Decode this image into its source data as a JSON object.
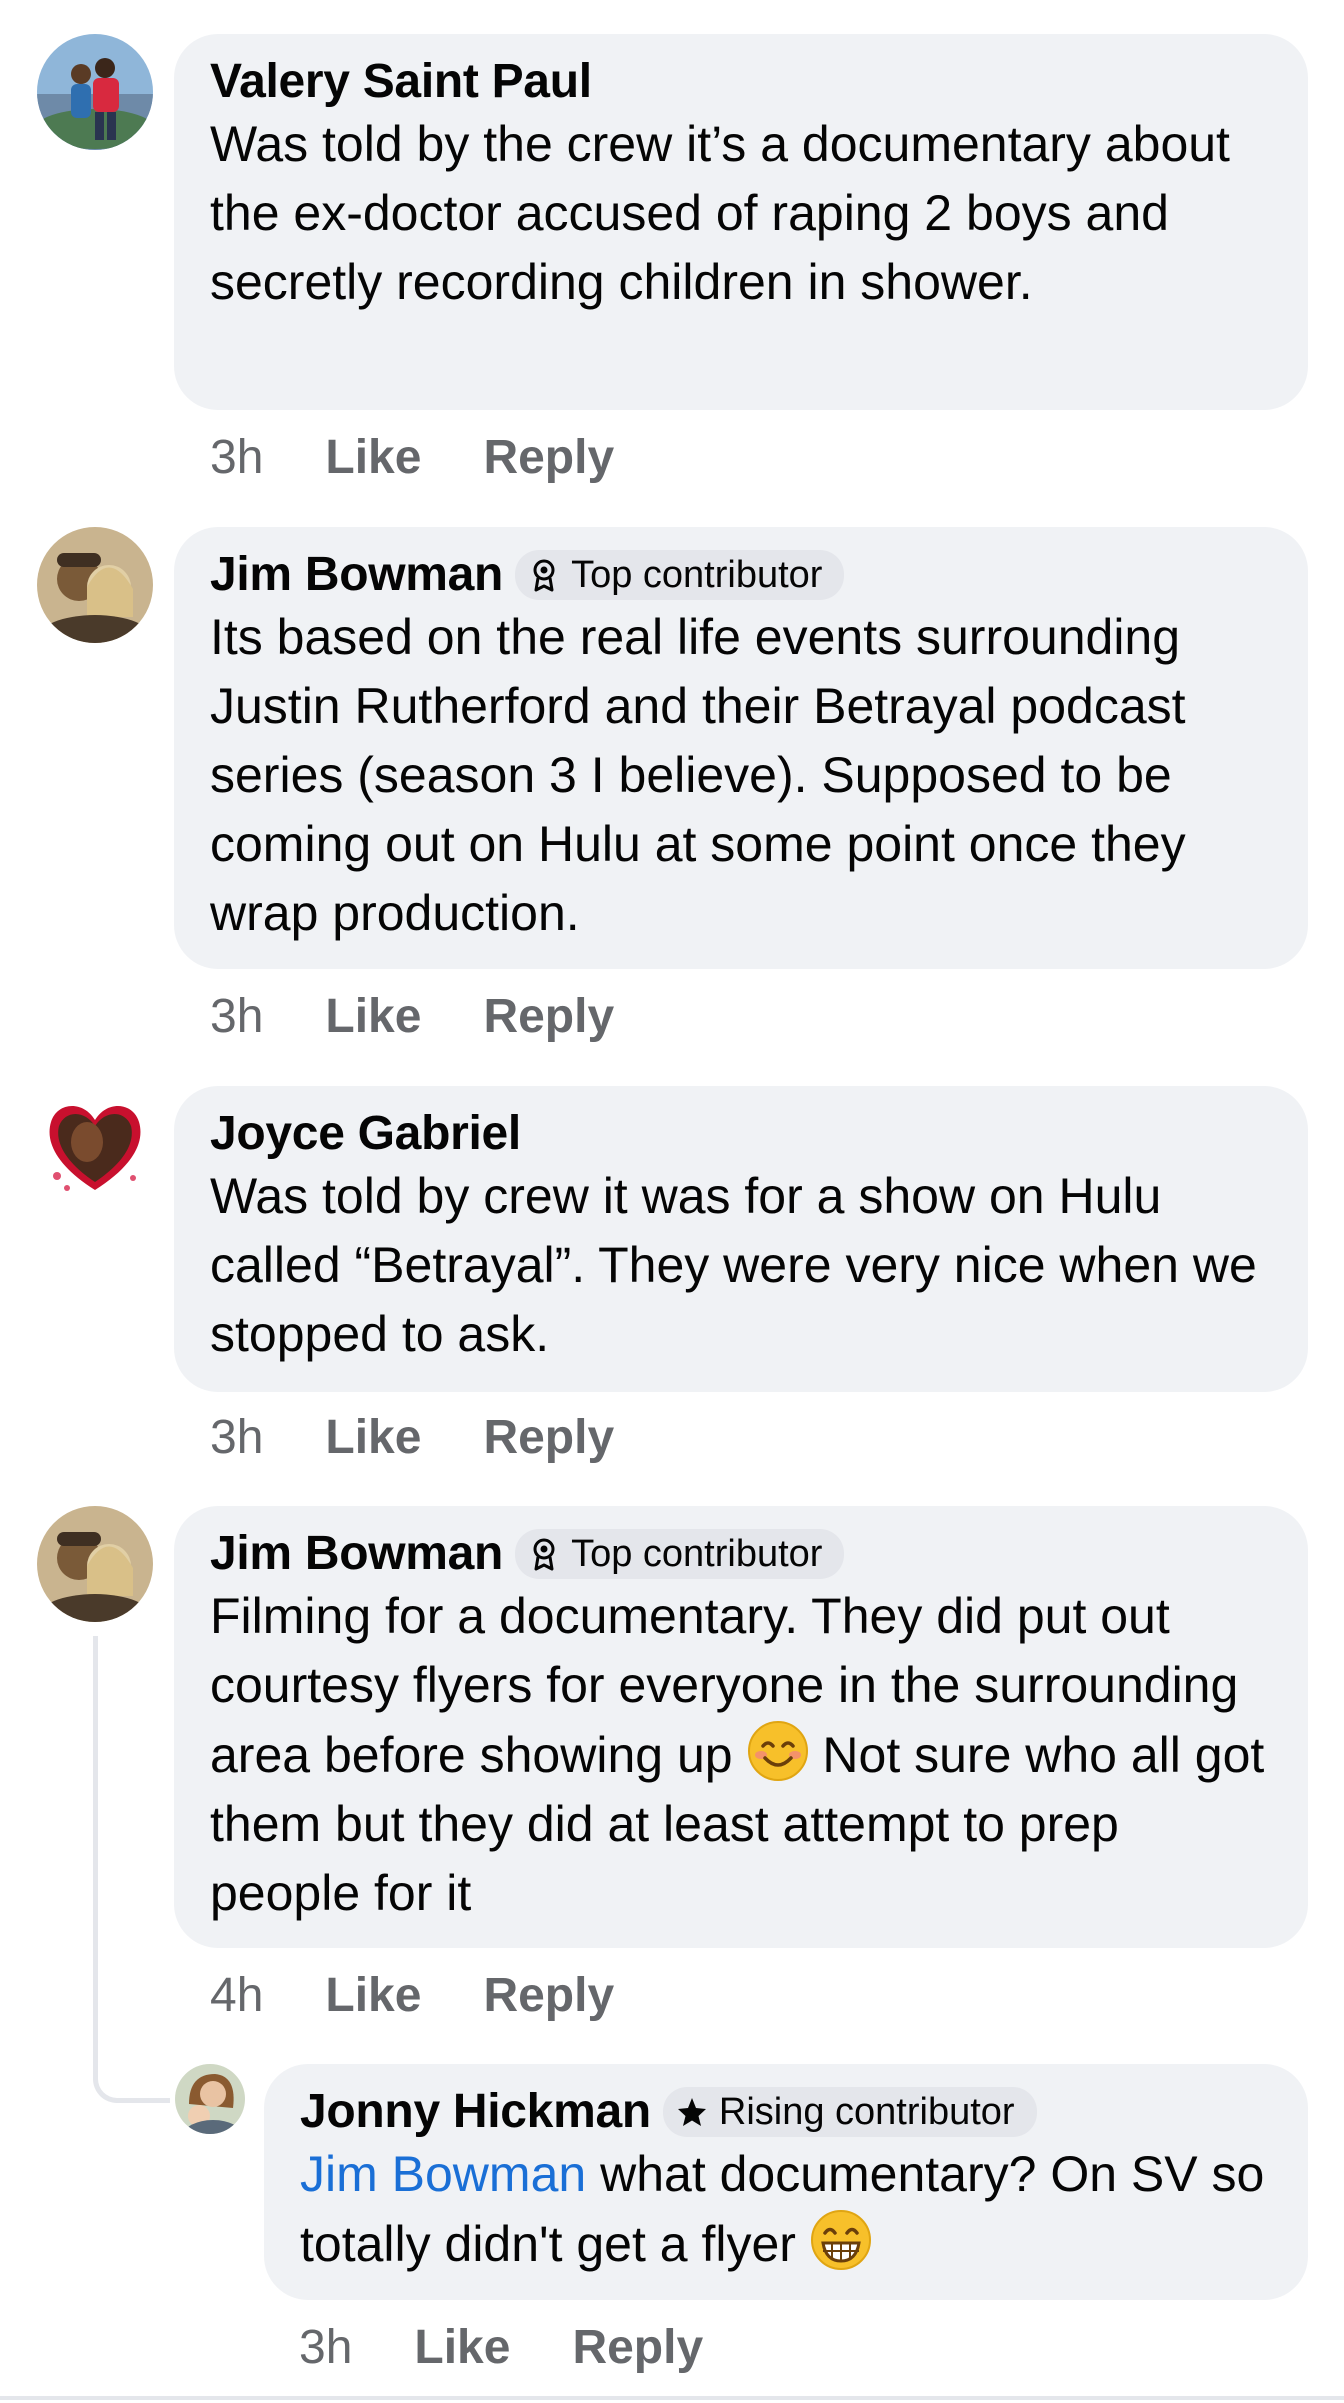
{
  "comments": [
    {
      "author": "Valery Saint Paul",
      "badge": null,
      "text": "Was told by the crew it’s a documentary about the ex-doctor accused of raping 2 boys and secretly recording children in shower.",
      "time": "3h",
      "like_label": "Like",
      "reply_label": "Reply"
    },
    {
      "author": "Jim Bowman",
      "badge": "Top contributor",
      "badge_icon": "top-contributor-icon",
      "text": "Its based on the real life events surrounding Justin Rutherford and their Betrayal podcast series (season 3 I believe). Supposed to be coming out on Hulu at some point once they wrap production.",
      "time": "3h",
      "like_label": "Like",
      "reply_label": "Reply"
    },
    {
      "author": "Joyce Gabriel",
      "badge": null,
      "text": "Was told by crew it was for a show on Hulu called “Betrayal”. They were very nice when we stopped to ask.",
      "time": "3h",
      "like_label": "Like",
      "reply_label": "Reply"
    },
    {
      "author": "Jim Bowman",
      "badge": "Top contributor",
      "badge_icon": "top-contributor-icon",
      "text_before_emoji": "Filming for a documentary. They did put out courtesy flyers for everyone in the surrounding area before showing up",
      "emoji": "smiling-face-emoji",
      "text_after_emoji": "Not sure who all got them but they did at least attempt to prep people for it",
      "time": "4h",
      "like_label": "Like",
      "reply_label": "Reply"
    }
  ],
  "reply": {
    "author": "Jonny Hickman",
    "badge": "Rising contributor",
    "badge_icon": "rising-contributor-star-icon",
    "mention": "Jim Bowman",
    "text": "what documentary? On SV so totally didn't get a flyer",
    "emoji": "grinning-face-emoji",
    "time": "3h",
    "like_label": "Like",
    "reply_label": "Reply"
  },
  "colors": {
    "bubble": "#f0f2f5",
    "secondary_text": "#65676b",
    "mention": "#1a6fd6",
    "badge_bg": "#e4e6eb"
  }
}
